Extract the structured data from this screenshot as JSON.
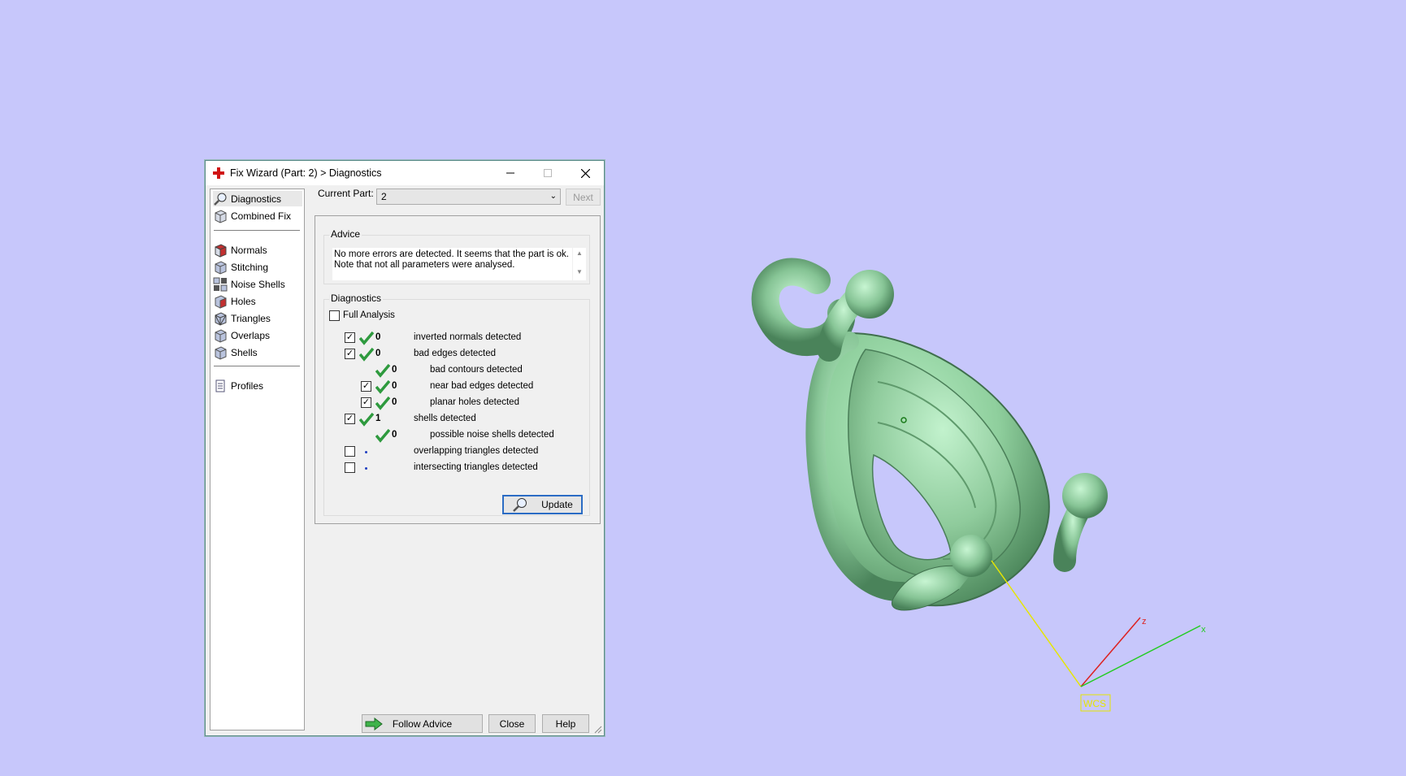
{
  "window": {
    "title": "Fix Wizard (Part: 2) > Diagnostics"
  },
  "nav": {
    "items": [
      {
        "label": "Diagnostics"
      },
      {
        "label": "Combined Fix"
      },
      {
        "label": "Normals"
      },
      {
        "label": "Stitching"
      },
      {
        "label": "Noise Shells"
      },
      {
        "label": "Holes"
      },
      {
        "label": "Triangles"
      },
      {
        "label": "Overlaps"
      },
      {
        "label": "Shells"
      },
      {
        "label": "Profiles"
      }
    ]
  },
  "toolbar": {
    "current_part_label": "Current Part:",
    "current_part_value": "2",
    "next_label": "Next"
  },
  "advice": {
    "title": "Advice",
    "line1": "No more errors are detected. It seems that the part is ok.",
    "line2": "Note that not all parameters were analysed."
  },
  "diagnostics": {
    "title": "Diagnostics",
    "full_analysis_label": "Full Analysis",
    "rows": [
      {
        "value": "0",
        "label": "inverted normals detected"
      },
      {
        "value": "0",
        "label": "bad edges detected"
      },
      {
        "value": "0",
        "label": "bad contours detected"
      },
      {
        "value": "0",
        "label": "near bad edges detected"
      },
      {
        "value": "0",
        "label": "planar holes detected"
      },
      {
        "value": "1",
        "label": "shells detected"
      },
      {
        "value": "0",
        "label": "possible noise shells detected"
      },
      {
        "value": "",
        "label": "overlapping triangles detected"
      },
      {
        "value": "",
        "label": "intersecting triangles detected"
      }
    ],
    "update_label": "Update"
  },
  "footer": {
    "follow_advice_label": "Follow Advice",
    "close_label": "Close",
    "help_label": "Help"
  },
  "viewport": {
    "axis_x": "x",
    "axis_z": "z",
    "wcs_label": "WCS"
  },
  "colors": {
    "background": "#c7c7fb",
    "model": "#8fd3a0",
    "axis_x": "#22cc22",
    "axis_y": "#e6e600",
    "axis_z": "#dd2222"
  }
}
